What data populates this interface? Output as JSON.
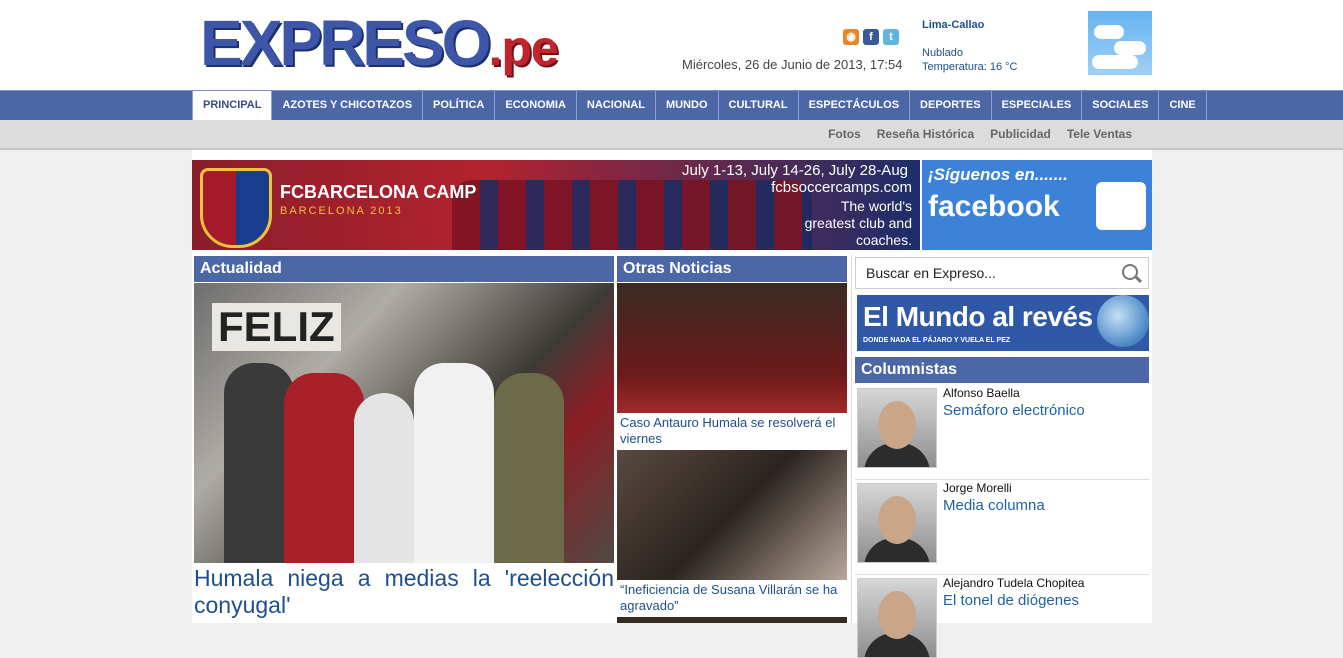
{
  "header": {
    "logo_main": "EXPRESO",
    "logo_tld": ".pe",
    "date": "Miércoles, 26 de Junio de 2013, 17:54",
    "social": [
      "rss-icon",
      "facebook-icon",
      "twitter-icon"
    ],
    "weather": {
      "city": "Lima-Callao",
      "condition": "Nublado",
      "temperature": "Temperatura: 16 °C",
      "icon": "cloudy-weather-icon"
    }
  },
  "nav": {
    "items": [
      "PRINCIPAL",
      "AZOTES Y CHICOTAZOS",
      "POLÍTICA",
      "ECONOMIA",
      "NACIONAL",
      "MUNDO",
      "CULTURAL",
      "ESPECTÁCULOS",
      "DEPORTES",
      "ESPECIALES",
      "SOCIALES",
      "CINE"
    ],
    "active": "PRINCIPAL"
  },
  "subnav": {
    "items": [
      "Fotos",
      "Reseña Histórica",
      "Publicidad",
      "Tele Ventas"
    ]
  },
  "banner": {
    "brand": "FCBARCELONA CAMP",
    "subtitle": "BARCELONA 2013",
    "dates": "July 1-13, July 14-26, July 28-Aug",
    "site": "fcbsoccercamps.com",
    "tagline": "The world's greatest club and coaches."
  },
  "fb_ad": {
    "line1": "¡Síguenos en.......",
    "line2": "facebook"
  },
  "actualidad": {
    "heading": "Actualidad",
    "photo_sign": "FELIZ",
    "headline": "Humala niega a medias la 'reelección conyugal'"
  },
  "otras": {
    "heading": "Otras Noticias",
    "items": [
      {
        "caption": "Caso Antauro Humala se resolverá el viernes"
      },
      {
        "caption": "“Ineficiencia de Susana Villarán se ha agravado”"
      }
    ]
  },
  "sidebar": {
    "search_placeholder": "Buscar en Expreso...",
    "mundo_title": "El Mundo al revés",
    "mundo_sub": "DONDE NADA EL PÁJARO Y VUELA EL PEZ",
    "columnistas_heading": "Columnistas",
    "columnists": [
      {
        "name": "Alfonso Baella",
        "title": "Semáforo electrónico"
      },
      {
        "name": "Jorge Morelli",
        "title": "Media columna"
      },
      {
        "name": "Alejandro Tudela Chopitea",
        "title": "El tonel de diógenes"
      }
    ]
  }
}
